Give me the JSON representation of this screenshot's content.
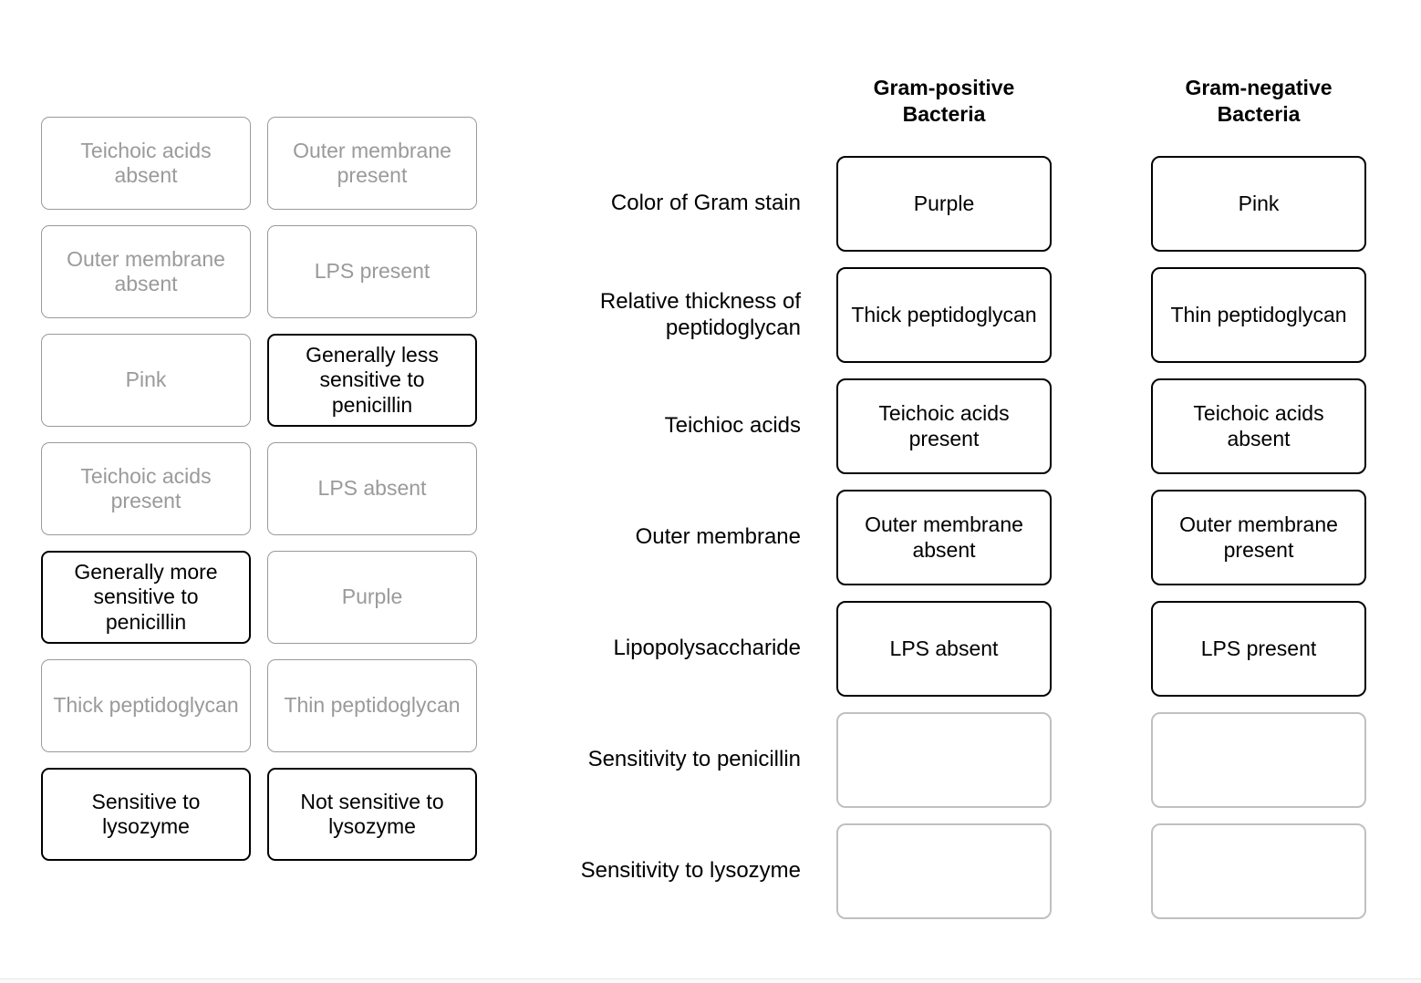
{
  "bank": {
    "left_column": [
      {
        "label": "Teichoic acids absent",
        "state": "used"
      },
      {
        "label": "Outer membrane absent",
        "state": "used"
      },
      {
        "label": "Pink",
        "state": "used"
      },
      {
        "label": "Teichoic acids present",
        "state": "used"
      },
      {
        "label": "Generally more sensitive to penicillin",
        "state": "available"
      },
      {
        "label": "Thick peptidoglycan",
        "state": "used"
      },
      {
        "label": "Sensitive to lysozyme",
        "state": "available"
      }
    ],
    "right_column": [
      {
        "label": "Outer membrane present",
        "state": "used"
      },
      {
        "label": "LPS present",
        "state": "used"
      },
      {
        "label": "Generally less sensitive to penicillin",
        "state": "available"
      },
      {
        "label": "LPS absent",
        "state": "used"
      },
      {
        "label": "Purple",
        "state": "used"
      },
      {
        "label": "Thin peptidoglycan",
        "state": "used"
      },
      {
        "label": "Not sensitive to lysozyme",
        "state": "available"
      }
    ]
  },
  "table": {
    "headers": {
      "gram_positive": "Gram-positive Bacteria",
      "gram_negative": "Gram-negative Bacteria"
    },
    "rows": [
      {
        "label": "Color of Gram stain",
        "gram_positive": {
          "value": "Purple",
          "state": "filled"
        },
        "gram_negative": {
          "value": "Pink",
          "state": "filled"
        }
      },
      {
        "label": "Relative thickness of peptidoglycan",
        "gram_positive": {
          "value": "Thick peptidoglycan",
          "state": "filled"
        },
        "gram_negative": {
          "value": "Thin peptidoglycan",
          "state": "filled"
        }
      },
      {
        "label": "Teichioc acids",
        "gram_positive": {
          "value": "Teichoic acids present",
          "state": "filled"
        },
        "gram_negative": {
          "value": "Teichoic acids absent",
          "state": "filled"
        }
      },
      {
        "label": "Outer membrane",
        "gram_positive": {
          "value": "Outer membrane absent",
          "state": "filled"
        },
        "gram_negative": {
          "value": "Outer membrane present",
          "state": "filled"
        }
      },
      {
        "label": "Lipopolysaccharide",
        "gram_positive": {
          "value": "LPS absent",
          "state": "filled"
        },
        "gram_negative": {
          "value": "LPS present",
          "state": "filled"
        }
      },
      {
        "label": "Sensitivity to penicillin",
        "gram_positive": {
          "value": "",
          "state": "empty"
        },
        "gram_negative": {
          "value": "",
          "state": "empty"
        }
      },
      {
        "label": "Sensitivity to lysozyme",
        "gram_positive": {
          "value": "",
          "state": "empty"
        },
        "gram_negative": {
          "value": "",
          "state": "empty"
        }
      }
    ]
  },
  "colors": {
    "used_tile_border": "#9a9a9a",
    "used_tile_text": "#9a9a9a",
    "available_tile_border": "#000000",
    "filled_slot_border": "#000000",
    "empty_slot_border": "#c0c0c0",
    "text": "#000000",
    "background": "#ffffff"
  }
}
